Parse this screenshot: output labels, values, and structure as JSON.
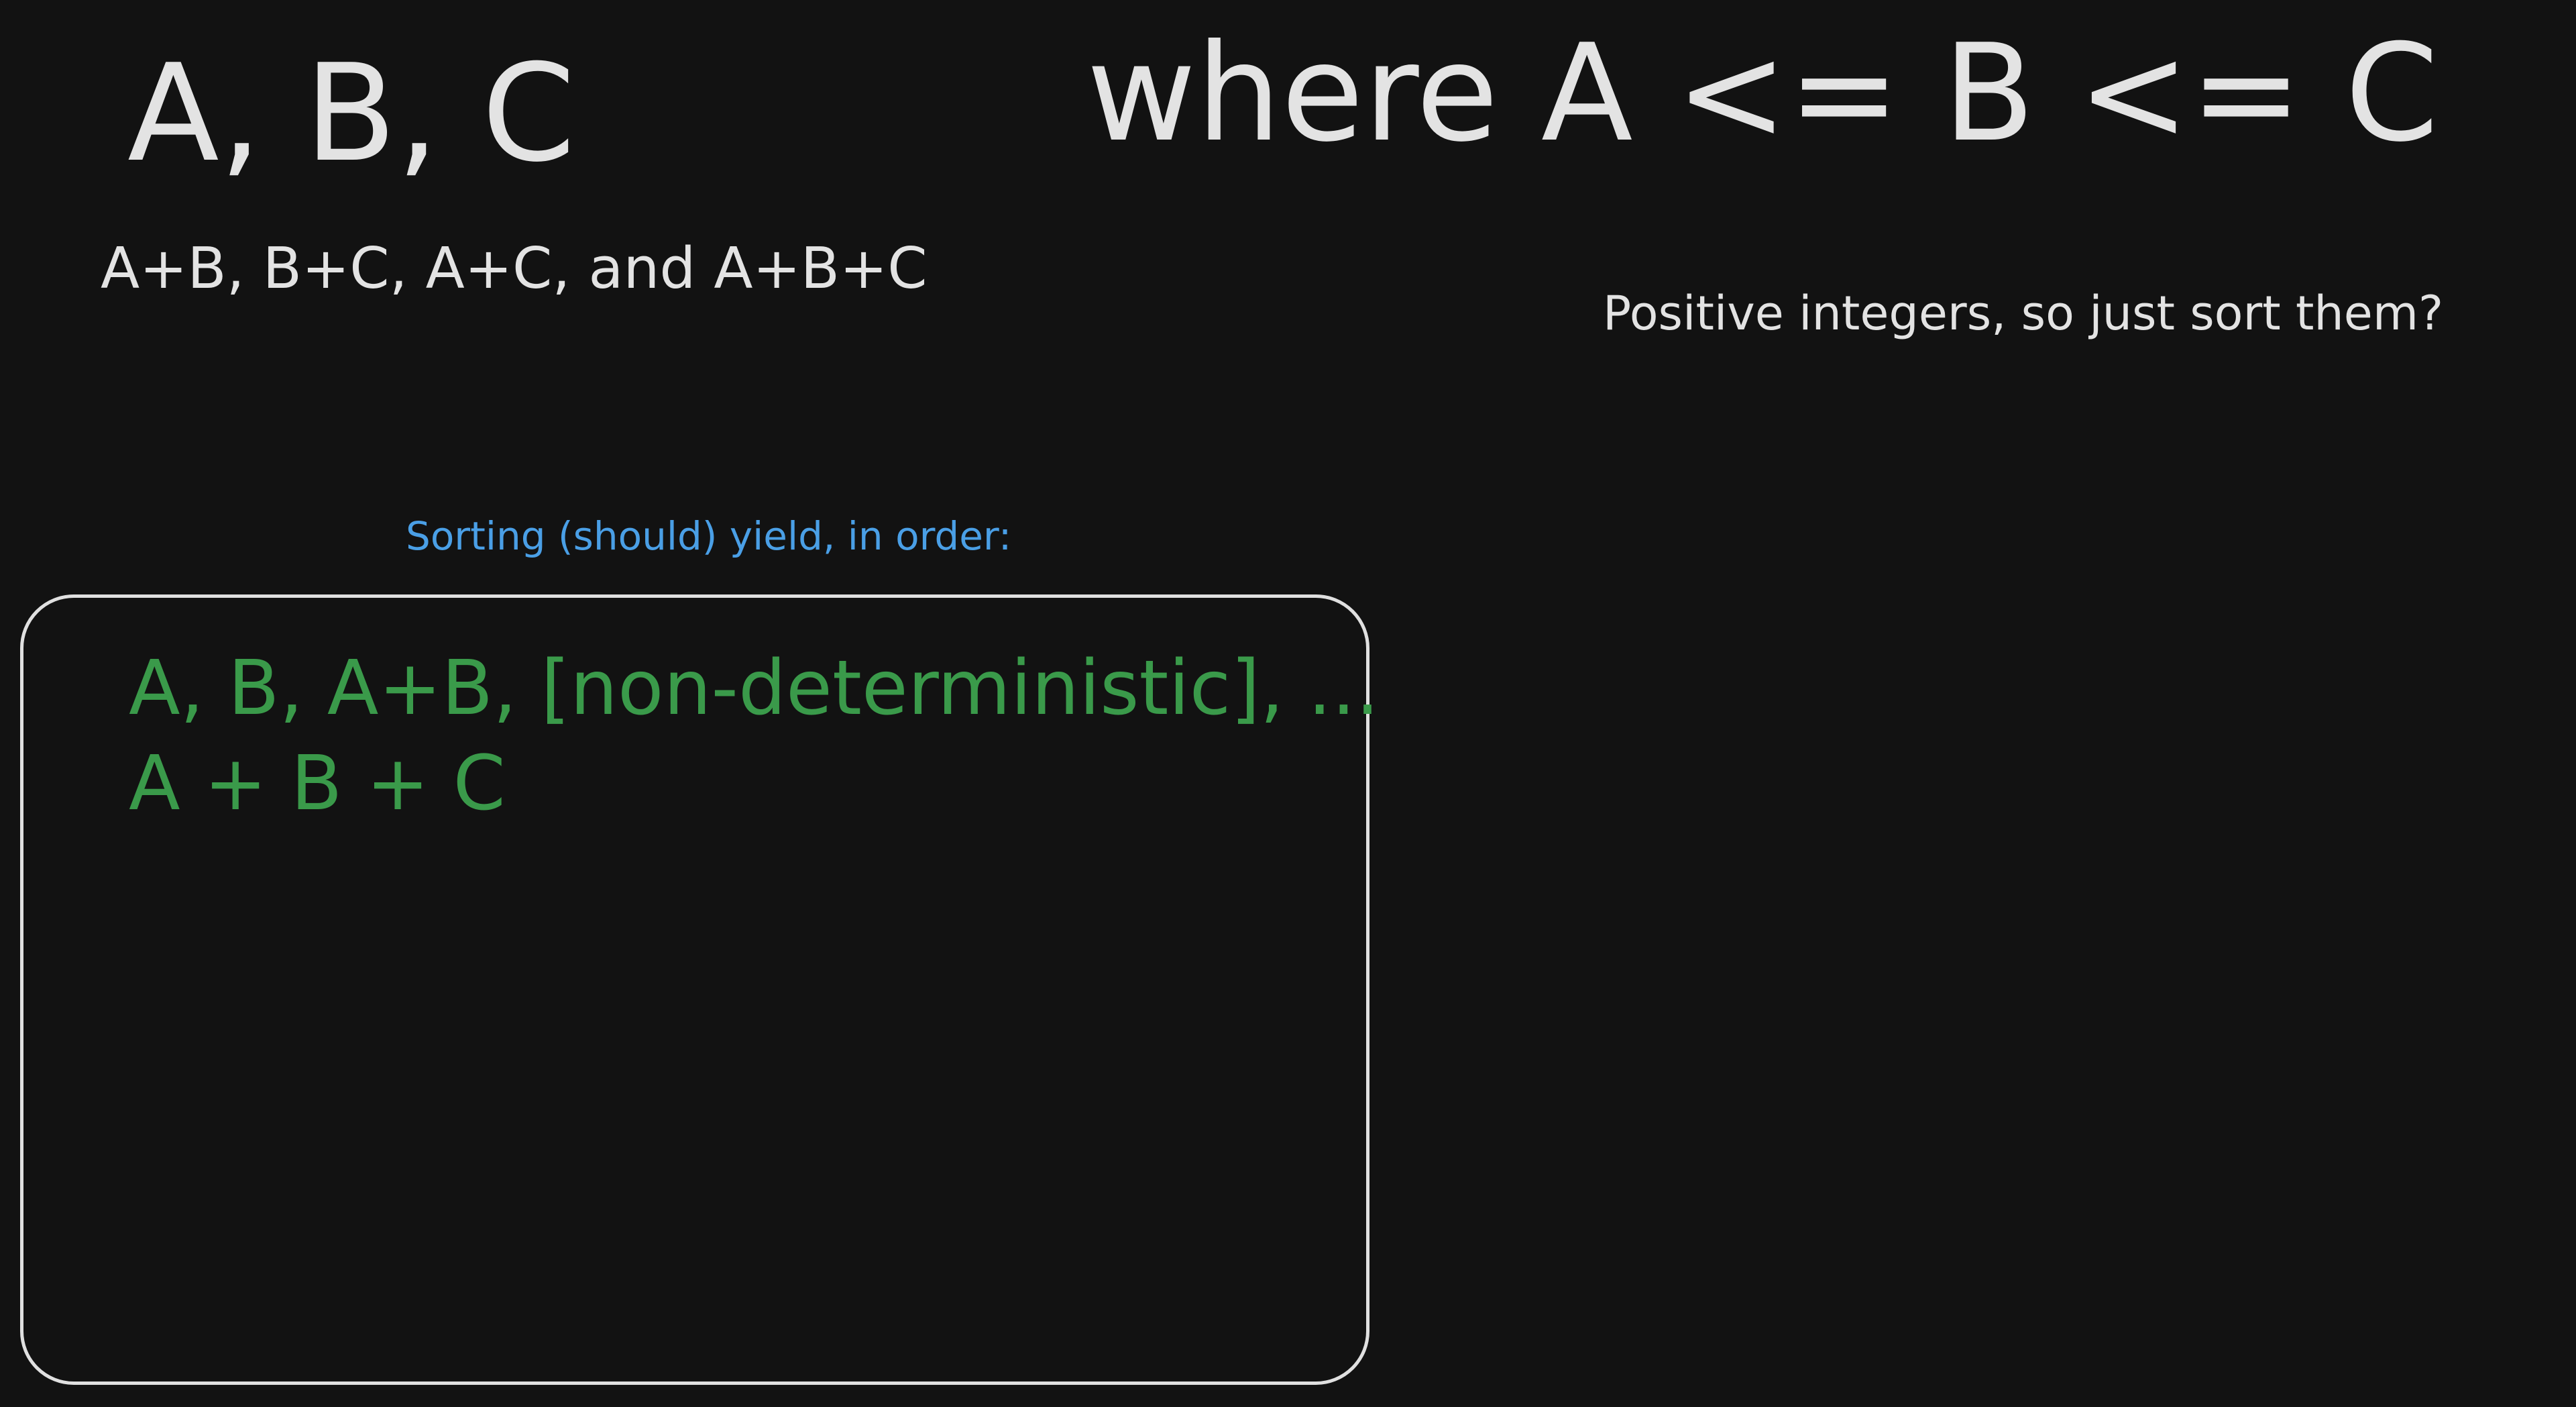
{
  "canvas": {
    "background": "#121212",
    "colors": {
      "text": "#e3e3e3",
      "caption": "#4a9fe6",
      "result": "#3a9a4a",
      "box_border": "#e0e0e0"
    }
  },
  "heading": {
    "variables": "A, B, C",
    "constraint": "where A <= B <= C"
  },
  "sums": "A+B, B+C, A+C, and A+B+C",
  "note": "Positive integers, so just sort them?",
  "caption": "Sorting (should) yield, in order:",
  "result_box": {
    "lines": [
      "A, B, A+B, [non-deterministic], ...",
      "A + B + C"
    ]
  }
}
